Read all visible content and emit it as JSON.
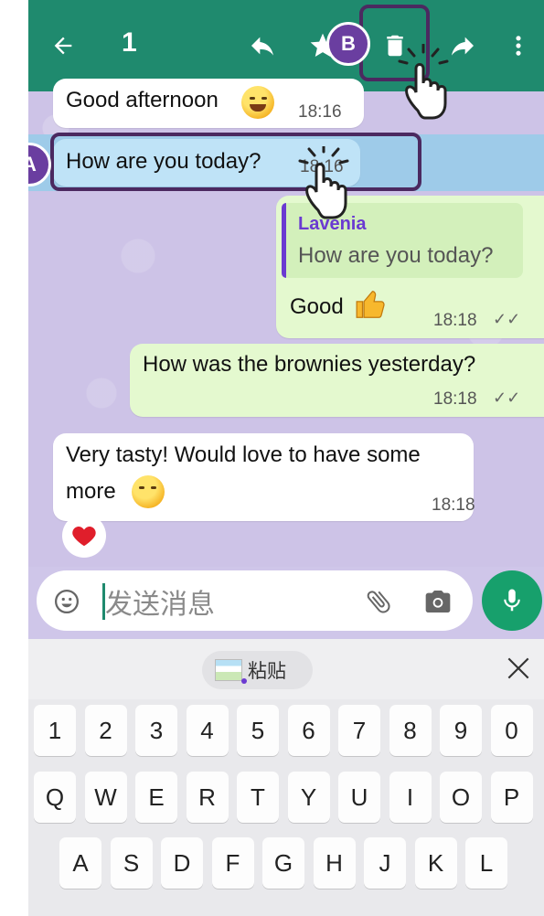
{
  "topbar": {
    "selected_count": "1",
    "icons": [
      "back-arrow-icon",
      "reply-icon",
      "star-icon",
      "delete-icon",
      "forward-icon",
      "more-vert-icon"
    ],
    "color": "#1f8a6e"
  },
  "messages": [
    {
      "direction": "in",
      "text": "Good afternoon",
      "emoji": "smiling-face",
      "time": "18:16"
    },
    {
      "direction": "in",
      "text": "How are you today?",
      "time": "18:16",
      "selected": true
    },
    {
      "direction": "out",
      "quote": {
        "author": "Lavenia",
        "text": "How are you today?"
      },
      "text": "Good",
      "emoji": "thumbs-up",
      "time": "18:18",
      "status": "read"
    },
    {
      "direction": "out",
      "text": "How was the brownies yesterday?",
      "time": "18:18",
      "status": "read"
    },
    {
      "direction": "in",
      "text_line1": "Very tasty! Would love to have some",
      "text_line2": "more",
      "emoji": "yum-face",
      "time": "18:18",
      "reaction": "red-heart"
    }
  ],
  "composer": {
    "placeholder": "发送消息",
    "icons": [
      "emoji-icon",
      "attach-icon",
      "camera-icon",
      "mic-icon"
    ]
  },
  "keyboard": {
    "paste_label": "粘贴",
    "row_numbers": [
      "1",
      "2",
      "3",
      "4",
      "5",
      "6",
      "7",
      "8",
      "9",
      "0"
    ],
    "row_q": [
      "Q",
      "W",
      "E",
      "R",
      "T",
      "Y",
      "U",
      "I",
      "O",
      "P"
    ],
    "row_a": [
      "A",
      "S",
      "D",
      "F",
      "G",
      "H",
      "J",
      "K",
      "L"
    ]
  },
  "annotations": {
    "a_label": "A",
    "b_label": "B",
    "color": "#4b2960"
  }
}
